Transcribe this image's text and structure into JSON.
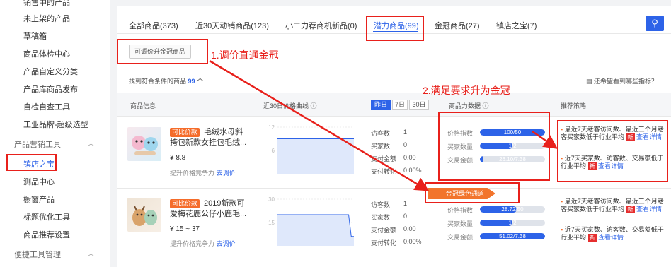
{
  "sidebar": {
    "items": [
      {
        "label": "销售中的产品"
      },
      {
        "label": "未上架的产品"
      },
      {
        "label": "草稿箱"
      },
      {
        "label": "商品体检中心"
      },
      {
        "label": "产品自定义分类"
      },
      {
        "label": "产品库商品发布"
      },
      {
        "label": "自检自查工具"
      },
      {
        "label": "工业品牌-超级选型"
      }
    ],
    "group_marketing": "产品营销工具",
    "marketing_items": [
      {
        "label": "镇店之宝"
      },
      {
        "label": "测品中心"
      },
      {
        "label": "橱窗产品"
      },
      {
        "label": "标题优化工具"
      },
      {
        "label": "商品推荐设置"
      }
    ],
    "group_tools": "便捷工具管理"
  },
  "tabs": [
    {
      "label": "全部商品(373)"
    },
    {
      "label": "近30天动销商品(123)"
    },
    {
      "label": "小二力荐商机新品(0)"
    },
    {
      "label": "潜力商品(99)"
    },
    {
      "label": "金冠商品(27)"
    },
    {
      "label": "镇店之宝(7)"
    }
  ],
  "filter_button": "可调价升金冠商品",
  "found": {
    "prefix": "找到符合条件的商品",
    "count": "99",
    "suffix": "个"
  },
  "help_link": "还希望看到哪些指标？",
  "table_header": {
    "product_info": "商品信息",
    "price_curve": "近30日价格曲线 ⓘ",
    "seg_yesterday": "昨日",
    "seg_7": "7日",
    "seg_30": "30日",
    "power": "商品力数据 ⓘ",
    "strategy": "推荐策略"
  },
  "rows": [
    {
      "badge": "可比价款",
      "title": "毛绒水母斜挎包新款女挂包毛绒...",
      "price": "¥ 8.8",
      "tip_prefix": "提升价格竞争力",
      "tip_link": "去调价",
      "chart_ticks": [
        "12",
        "6"
      ],
      "chart_points": [
        9,
        9,
        9,
        9,
        9,
        9,
        9,
        9,
        9,
        9,
        9,
        9,
        9,
        9,
        9,
        9,
        9,
        9,
        9,
        9,
        9,
        9,
        9,
        9,
        9,
        9,
        9,
        9,
        9,
        9
      ],
      "chart_max": 12,
      "stats": [
        {
          "label": "访客数",
          "value": "1"
        },
        {
          "label": "买家数",
          "value": "0"
        },
        {
          "label": "支付金额",
          "value": "0.00"
        },
        {
          "label": "支付转化",
          "value": "0.00%"
        }
      ],
      "power": [
        {
          "label": "价格指数",
          "text": "100/50",
          "fill": 1.0
        },
        {
          "label": "买家数量",
          "text": "1/2",
          "fill": 0.5
        },
        {
          "label": "交易金额",
          "text": "26.10/7.38",
          "fill": 0.05
        }
      ],
      "recs": [
        {
          "text": "最近7天老客访问数、最近三个月老客买家数低于行业平均",
          "new": "新",
          "link": "查看详情"
        },
        {
          "text": "近7天买家数、访客数、交易额低于行业平均",
          "new": "新",
          "link": "查看详情"
        }
      ]
    },
    {
      "badge": "可比价款",
      "title": "2019新款可爱梅花鹿公仔小鹿毛...",
      "price": "¥ 15 ~ 37",
      "tip_prefix": "提升价格竞争力",
      "tip_link": "去调价",
      "chart_ticks": [
        "30",
        "15"
      ],
      "chart_points": [
        20,
        20,
        20,
        20,
        20,
        20,
        20,
        20,
        20,
        20,
        20,
        20,
        20,
        20,
        20,
        20,
        20,
        20,
        20,
        20,
        20,
        20,
        20,
        20,
        20,
        20,
        20,
        20,
        6,
        6
      ],
      "chart_max": 30,
      "stats": [
        {
          "label": "访客数",
          "value": "1"
        },
        {
          "label": "买家数",
          "value": "0"
        },
        {
          "label": "支付金额",
          "value": "0.00"
        },
        {
          "label": "支付转化",
          "value": "0.00%"
        }
      ],
      "power": [
        {
          "label": "价格指数",
          "text": "28.72/50",
          "fill": 0.57
        },
        {
          "label": "买家数量",
          "text": "1/2",
          "fill": 0.5
        },
        {
          "label": "交易金额",
          "text": "51.02/7.38",
          "fill": 1.0
        }
      ],
      "recs": [
        {
          "text": "最近7天老客访问数、最近三个月老客买家数低于行业平均",
          "new": "新",
          "link": "查看详情"
        },
        {
          "text": "近7天买家数、访客数、交易额低于行业平均",
          "new": "新",
          "link": "查看详情"
        }
      ]
    }
  ],
  "annotations": {
    "a1": "1.调价直通金冠",
    "a2": "2.满足要求升为金冠",
    "channel": "金冠绿色通道"
  },
  "colors": {
    "accent": "#2d63e8",
    "annotation_red": "#e8201b",
    "orange": "#f56c2a"
  }
}
